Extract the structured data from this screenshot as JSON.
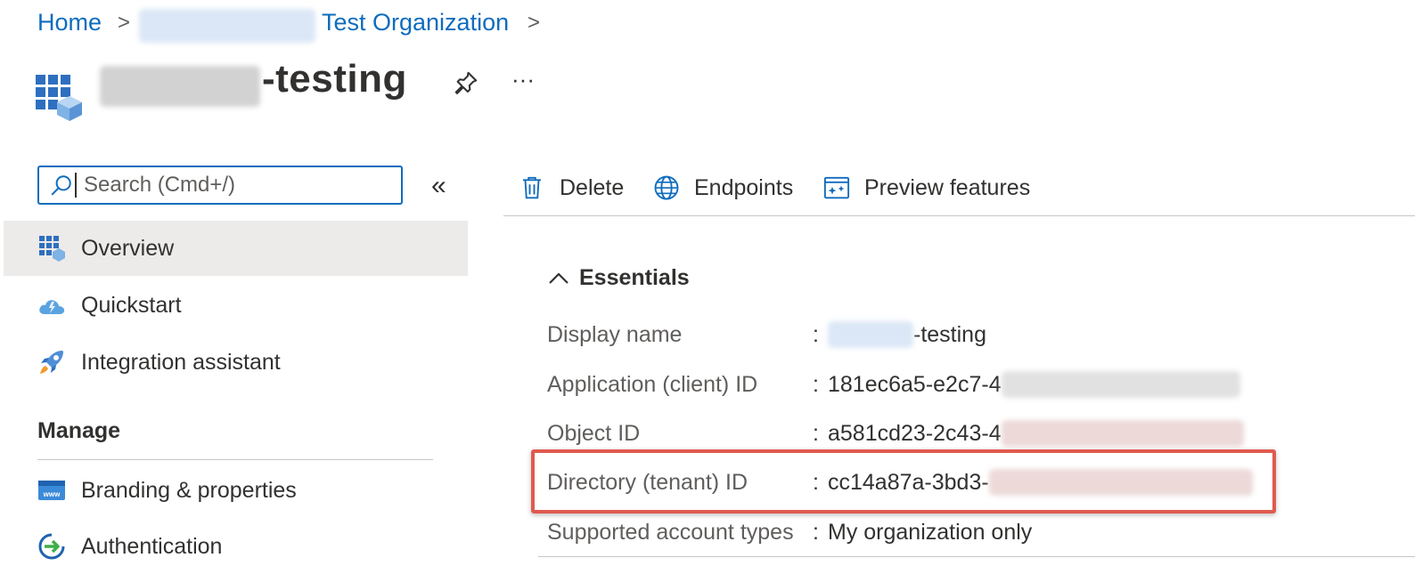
{
  "breadcrumb": {
    "home": "Home",
    "org": "Test Organization"
  },
  "app": {
    "title_suffix": "-testing",
    "more": "···"
  },
  "search": {
    "placeholder": "Search (Cmd+/)",
    "collapse": "«"
  },
  "nav": {
    "items": [
      {
        "label": "Overview",
        "icon": "app-grid-icon",
        "selected": true
      },
      {
        "label": "Quickstart",
        "icon": "cloud-icon"
      },
      {
        "label": "Integration assistant",
        "icon": "rocket-icon"
      }
    ],
    "manage_header": "Manage",
    "manage_items": [
      {
        "label": "Branding & properties",
        "icon": "www-icon"
      },
      {
        "label": "Authentication",
        "icon": "auth-arrow-icon"
      }
    ]
  },
  "toolbar": {
    "delete": "Delete",
    "endpoints": "Endpoints",
    "preview": "Preview features"
  },
  "essentials": {
    "header": "Essentials",
    "rows": [
      {
        "key": "Display name",
        "value": "-testing",
        "link": true
      },
      {
        "key": "Application (client) ID",
        "value": "181ec6a5-e2c7-4"
      },
      {
        "key": "Object ID",
        "value": "a581cd23-2c43-4"
      },
      {
        "key": "Directory (tenant) ID",
        "value": "cc14a87a-3bd3-"
      },
      {
        "key": "Supported account types",
        "value": "My organization only",
        "link": true
      }
    ]
  },
  "colors": {
    "accent": "#0f6cbd",
    "highlight": "#e05a4e",
    "selected_bg": "#edebe9"
  }
}
